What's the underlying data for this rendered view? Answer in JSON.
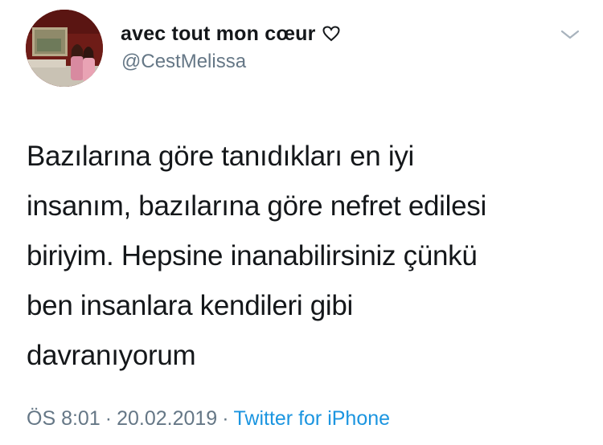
{
  "user": {
    "display_name": "avec tout mon cœur",
    "handle": "@CestMelissa"
  },
  "tweet": {
    "lines": [
      "Bazılarına göre tanıdıkları en iyi",
      "insanım, bazılarına göre nefret edilesi",
      "biriyim. Hepsine inanabilirsiniz çünkü",
      "ben insanlara kendileri gibi",
      "davranıyorum"
    ]
  },
  "meta": {
    "time": "ÖS 8:01",
    "separator": "·",
    "date": "20.02.2019",
    "source": "Twitter for iPhone"
  },
  "icons": {
    "name_emoji": "heart-outline-icon",
    "menu": "chevron-down-icon"
  },
  "colors": {
    "text": "#14171a",
    "secondary": "#657786",
    "link": "#1b95e0"
  }
}
